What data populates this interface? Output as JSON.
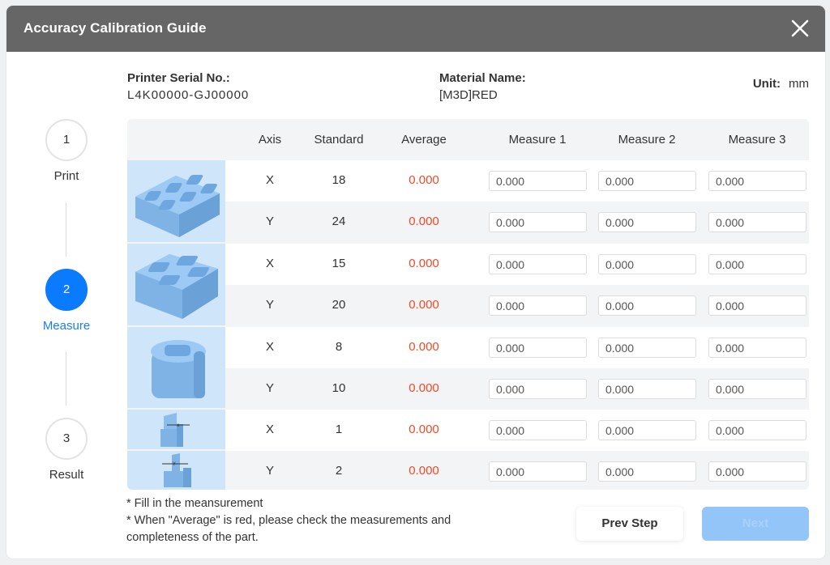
{
  "dialog": {
    "title": "Accuracy Calibration Guide",
    "close_icon": "close-icon"
  },
  "info": {
    "serial_label": "Printer Serial No.:",
    "serial_value": "L4K00000-GJ00000",
    "material_label": "Material Name:",
    "material_value": "[M3D]RED",
    "unit_label": "Unit:",
    "unit_value": "mm"
  },
  "stepper": {
    "steps": [
      {
        "number": "1",
        "label": "Print",
        "state": "done"
      },
      {
        "number": "2",
        "label": "Measure",
        "state": "active"
      },
      {
        "number": "3",
        "label": "Result",
        "state": "pending"
      }
    ]
  },
  "colors": {
    "accent": "#0a7bff",
    "average_warning": "#f04a26",
    "header_bg": "#666666",
    "image_bg": "#cfe6fa",
    "next_disabled": "#93c5f8"
  },
  "table": {
    "headers": {
      "image": "",
      "axis": "Axis",
      "standard": "Standard",
      "average": "Average",
      "measure1": "Measure 1",
      "measure2": "Measure 2",
      "measure3": "Measure 3"
    },
    "parts": [
      {
        "image": "six-cavity-block-image"
      },
      {
        "image": "four-cavity-block-image"
      },
      {
        "image": "single-cavity-block-image"
      },
      {
        "image": "x-axis-fin-image"
      },
      {
        "image": "y-axis-fin-image"
      }
    ],
    "rows": [
      {
        "axis": "X",
        "standard": "18",
        "average": "0.000",
        "m1": "0.000",
        "m2": "0.000",
        "m3": "0.000"
      },
      {
        "axis": "Y",
        "standard": "24",
        "average": "0.000",
        "m1": "0.000",
        "m2": "0.000",
        "m3": "0.000"
      },
      {
        "axis": "X",
        "standard": "15",
        "average": "0.000",
        "m1": "0.000",
        "m2": "0.000",
        "m3": "0.000"
      },
      {
        "axis": "Y",
        "standard": "20",
        "average": "0.000",
        "m1": "0.000",
        "m2": "0.000",
        "m3": "0.000"
      },
      {
        "axis": "X",
        "standard": "8",
        "average": "0.000",
        "m1": "0.000",
        "m2": "0.000",
        "m3": "0.000"
      },
      {
        "axis": "Y",
        "standard": "10",
        "average": "0.000",
        "m1": "0.000",
        "m2": "0.000",
        "m3": "0.000"
      },
      {
        "axis": "X",
        "standard": "1",
        "average": "0.000",
        "m1": "0.000",
        "m2": "0.000",
        "m3": "0.000"
      },
      {
        "axis": "Y",
        "standard": "2",
        "average": "0.000",
        "m1": "0.000",
        "m2": "0.000",
        "m3": "0.000"
      }
    ]
  },
  "notes": {
    "line1": "* Fill in the meansurement",
    "line2": "* When \"Average\" is red, please check the measurements and completeness of the part."
  },
  "buttons": {
    "prev": "Prev Step",
    "next": "Next"
  }
}
